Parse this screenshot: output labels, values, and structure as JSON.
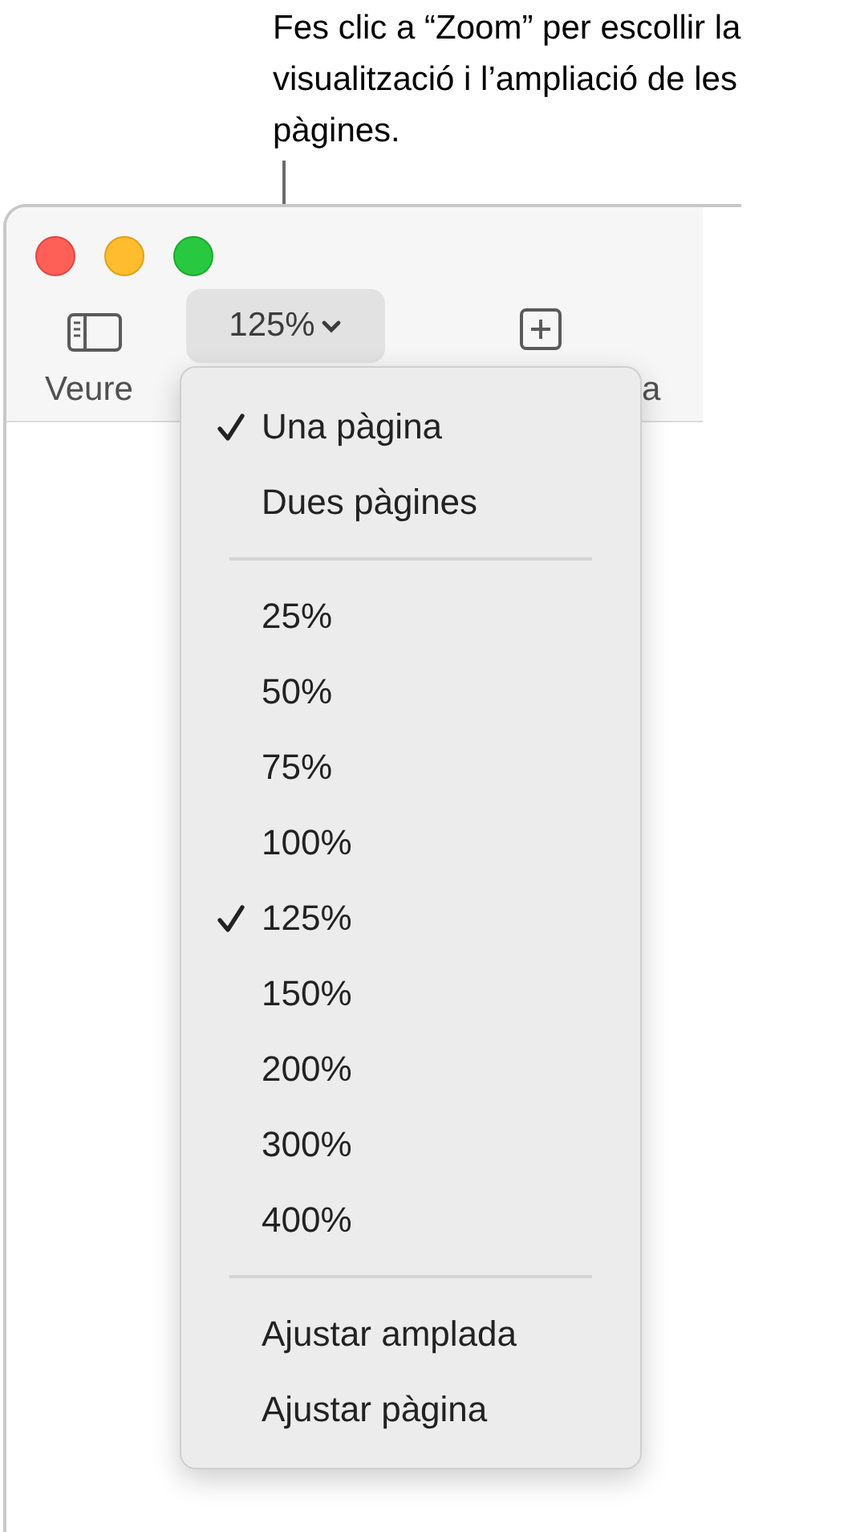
{
  "callout": "Fes clic a “Zoom” per escollir la visualització i l’ampliació de les pàgines.",
  "toolbar": {
    "view_label": "Veure",
    "zoom_button": "125%",
    "add_label": "a"
  },
  "menu": [
    {
      "kind": "item",
      "label": "Una pàgina",
      "checked": true
    },
    {
      "kind": "item",
      "label": "Dues pàgines",
      "checked": false
    },
    {
      "kind": "separator"
    },
    {
      "kind": "item",
      "label": "25%",
      "checked": false
    },
    {
      "kind": "item",
      "label": "50%",
      "checked": false
    },
    {
      "kind": "item",
      "label": "75%",
      "checked": false
    },
    {
      "kind": "item",
      "label": "100%",
      "checked": false
    },
    {
      "kind": "item",
      "label": "125%",
      "checked": true
    },
    {
      "kind": "item",
      "label": "150%",
      "checked": false
    },
    {
      "kind": "item",
      "label": "200%",
      "checked": false
    },
    {
      "kind": "item",
      "label": "300%",
      "checked": false
    },
    {
      "kind": "item",
      "label": "400%",
      "checked": false
    },
    {
      "kind": "separator"
    },
    {
      "kind": "item",
      "label": "Ajustar amplada",
      "checked": false
    },
    {
      "kind": "item",
      "label": "Ajustar pàgina",
      "checked": false
    }
  ]
}
